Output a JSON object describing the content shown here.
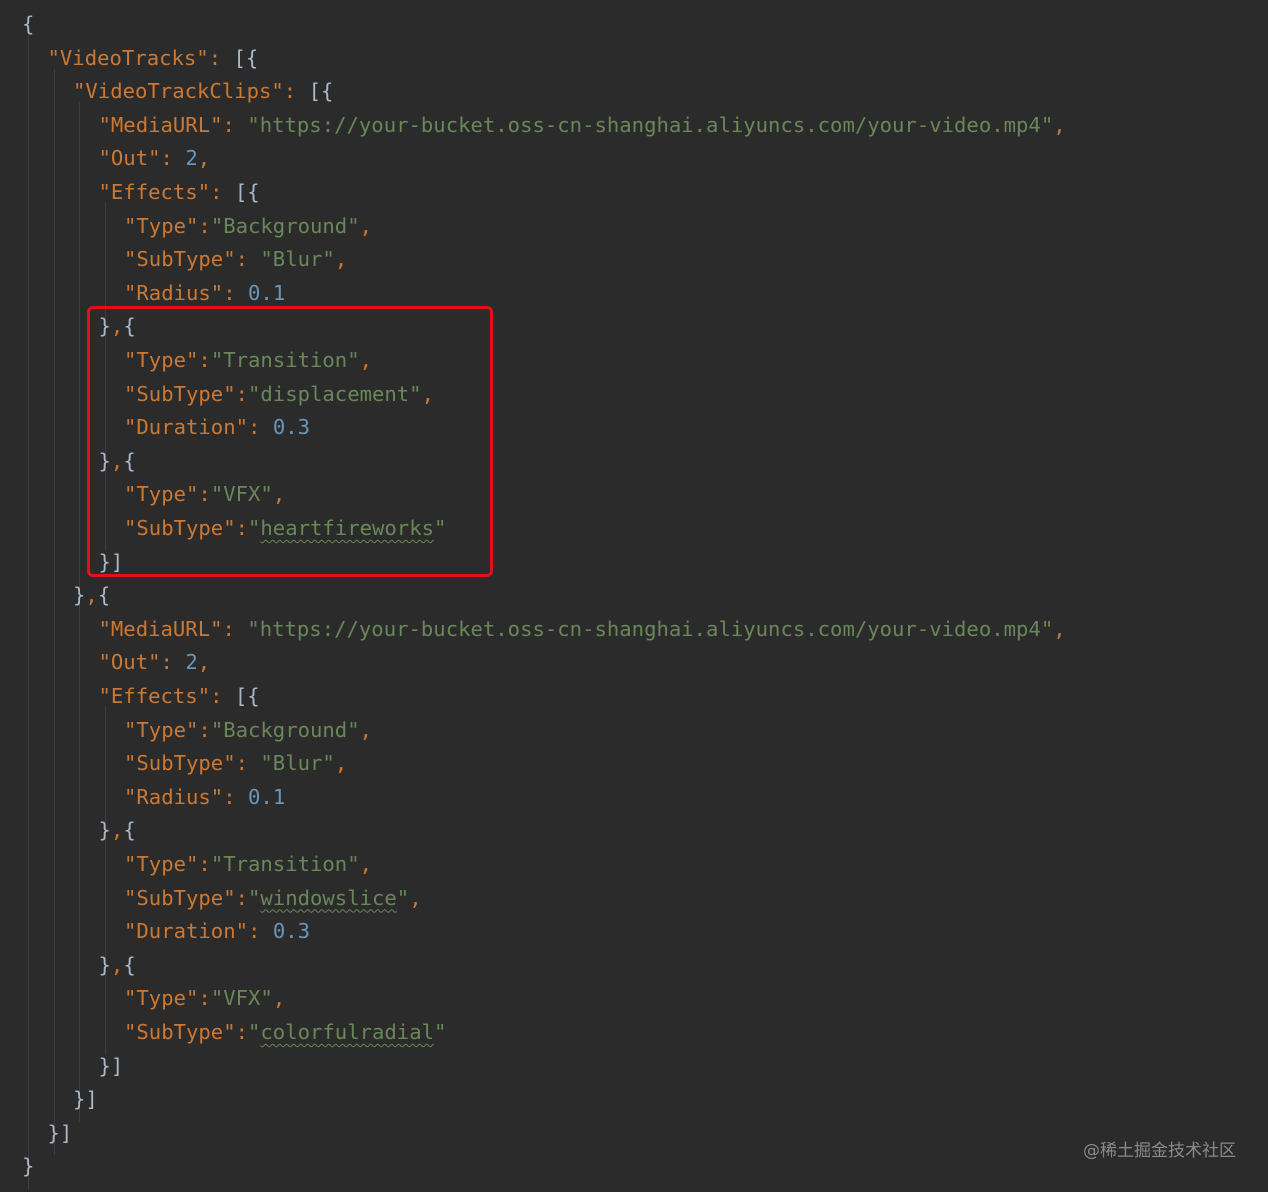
{
  "watermark": "@稀土掘金技术社区",
  "colors": {
    "background": "#2b2b2b",
    "key": "#cc7832",
    "string": "#6a8759",
    "number": "#6897bb",
    "brace": "#a9b7c6",
    "highlight": "#e3101c"
  },
  "code": [
    {
      "indent": 0,
      "tokens": [
        {
          "t": "{",
          "c": "brace"
        }
      ]
    },
    {
      "indent": 1,
      "tokens": [
        {
          "t": "\"VideoTracks\"",
          "c": "key"
        },
        {
          "t": ": ",
          "c": "punct"
        },
        {
          "t": "[{",
          "c": "brace"
        }
      ]
    },
    {
      "indent": 2,
      "tokens": [
        {
          "t": "\"VideoTrackClips\"",
          "c": "key"
        },
        {
          "t": ": ",
          "c": "punct"
        },
        {
          "t": "[{",
          "c": "brace"
        }
      ]
    },
    {
      "indent": 3,
      "tokens": [
        {
          "t": "\"MediaURL\"",
          "c": "key"
        },
        {
          "t": ": ",
          "c": "punct"
        },
        {
          "t": "\"https://your-bucket.oss-cn-shanghai.aliyuncs.com/your-video.mp4\"",
          "c": "str"
        },
        {
          "t": ",",
          "c": "punct"
        }
      ]
    },
    {
      "indent": 3,
      "tokens": [
        {
          "t": "\"Out\"",
          "c": "key"
        },
        {
          "t": ": ",
          "c": "punct"
        },
        {
          "t": "2",
          "c": "num"
        },
        {
          "t": ",",
          "c": "punct"
        }
      ]
    },
    {
      "indent": 3,
      "tokens": [
        {
          "t": "\"Effects\"",
          "c": "key"
        },
        {
          "t": ": ",
          "c": "punct"
        },
        {
          "t": "[{",
          "c": "brace"
        }
      ]
    },
    {
      "indent": 4,
      "tokens": [
        {
          "t": "\"Type\"",
          "c": "key"
        },
        {
          "t": ":",
          "c": "punct"
        },
        {
          "t": "\"Background\"",
          "c": "str"
        },
        {
          "t": ",",
          "c": "punct"
        }
      ]
    },
    {
      "indent": 4,
      "tokens": [
        {
          "t": "\"SubType\"",
          "c": "key"
        },
        {
          "t": ": ",
          "c": "punct"
        },
        {
          "t": "\"Blur\"",
          "c": "str"
        },
        {
          "t": ",",
          "c": "punct"
        }
      ]
    },
    {
      "indent": 4,
      "tokens": [
        {
          "t": "\"Radius\"",
          "c": "key"
        },
        {
          "t": ": ",
          "c": "punct"
        },
        {
          "t": "0.1",
          "c": "num"
        }
      ]
    },
    {
      "indent": 3,
      "tokens": [
        {
          "t": "}",
          "c": "brace"
        },
        {
          "t": ",",
          "c": "punct"
        },
        {
          "t": "{",
          "c": "brace"
        }
      ]
    },
    {
      "indent": 4,
      "tokens": [
        {
          "t": "\"Type\"",
          "c": "key"
        },
        {
          "t": ":",
          "c": "punct"
        },
        {
          "t": "\"Transition\"",
          "c": "str"
        },
        {
          "t": ",",
          "c": "punct"
        }
      ]
    },
    {
      "indent": 4,
      "tokens": [
        {
          "t": "\"SubType\"",
          "c": "key"
        },
        {
          "t": ":",
          "c": "punct"
        },
        {
          "t": "\"displacement\"",
          "c": "str"
        },
        {
          "t": ",",
          "c": "punct"
        }
      ]
    },
    {
      "indent": 4,
      "tokens": [
        {
          "t": "\"Duration\"",
          "c": "key"
        },
        {
          "t": ": ",
          "c": "punct"
        },
        {
          "t": "0.3",
          "c": "num"
        }
      ]
    },
    {
      "indent": 3,
      "tokens": [
        {
          "t": "}",
          "c": "brace"
        },
        {
          "t": ",",
          "c": "punct"
        },
        {
          "t": "{",
          "c": "brace"
        }
      ]
    },
    {
      "indent": 4,
      "tokens": [
        {
          "t": "\"Type\"",
          "c": "key"
        },
        {
          "t": ":",
          "c": "punct"
        },
        {
          "t": "\"VFX\"",
          "c": "str"
        },
        {
          "t": ",",
          "c": "punct"
        }
      ]
    },
    {
      "indent": 4,
      "tokens": [
        {
          "t": "\"SubType\"",
          "c": "key"
        },
        {
          "t": ":",
          "c": "punct"
        },
        {
          "t": "\"",
          "c": "str"
        },
        {
          "t": "heartfireworks",
          "c": "str",
          "typo": true
        },
        {
          "t": "\"",
          "c": "str"
        }
      ]
    },
    {
      "indent": 3,
      "tokens": [
        {
          "t": "}]",
          "c": "brace"
        }
      ]
    },
    {
      "indent": 2,
      "tokens": [
        {
          "t": "}",
          "c": "brace"
        },
        {
          "t": ",",
          "c": "punct"
        },
        {
          "t": "{",
          "c": "brace"
        }
      ]
    },
    {
      "indent": 3,
      "tokens": [
        {
          "t": "\"MediaURL\"",
          "c": "key"
        },
        {
          "t": ": ",
          "c": "punct"
        },
        {
          "t": "\"https://your-bucket.oss-cn-shanghai.aliyuncs.com/your-video.mp4\"",
          "c": "str"
        },
        {
          "t": ",",
          "c": "punct"
        }
      ]
    },
    {
      "indent": 3,
      "tokens": [
        {
          "t": "\"Out\"",
          "c": "key"
        },
        {
          "t": ": ",
          "c": "punct"
        },
        {
          "t": "2",
          "c": "num"
        },
        {
          "t": ",",
          "c": "punct"
        }
      ]
    },
    {
      "indent": 3,
      "tokens": [
        {
          "t": "\"Effects\"",
          "c": "key"
        },
        {
          "t": ": ",
          "c": "punct"
        },
        {
          "t": "[{",
          "c": "brace"
        }
      ]
    },
    {
      "indent": 4,
      "tokens": [
        {
          "t": "\"Type\"",
          "c": "key"
        },
        {
          "t": ":",
          "c": "punct"
        },
        {
          "t": "\"Background\"",
          "c": "str"
        },
        {
          "t": ",",
          "c": "punct"
        }
      ]
    },
    {
      "indent": 4,
      "tokens": [
        {
          "t": "\"SubType\"",
          "c": "key"
        },
        {
          "t": ": ",
          "c": "punct"
        },
        {
          "t": "\"Blur\"",
          "c": "str"
        },
        {
          "t": ",",
          "c": "punct"
        }
      ]
    },
    {
      "indent": 4,
      "tokens": [
        {
          "t": "\"Radius\"",
          "c": "key"
        },
        {
          "t": ": ",
          "c": "punct"
        },
        {
          "t": "0.1",
          "c": "num"
        }
      ]
    },
    {
      "indent": 3,
      "tokens": [
        {
          "t": "}",
          "c": "brace"
        },
        {
          "t": ",",
          "c": "punct"
        },
        {
          "t": "{",
          "c": "brace"
        }
      ]
    },
    {
      "indent": 4,
      "tokens": [
        {
          "t": "\"Type\"",
          "c": "key"
        },
        {
          "t": ":",
          "c": "punct"
        },
        {
          "t": "\"Transition\"",
          "c": "str"
        },
        {
          "t": ",",
          "c": "punct"
        }
      ]
    },
    {
      "indent": 4,
      "tokens": [
        {
          "t": "\"SubType\"",
          "c": "key"
        },
        {
          "t": ":",
          "c": "punct"
        },
        {
          "t": "\"",
          "c": "str"
        },
        {
          "t": "windowslice",
          "c": "str",
          "typo": true
        },
        {
          "t": "\"",
          "c": "str"
        },
        {
          "t": ",",
          "c": "punct"
        }
      ]
    },
    {
      "indent": 4,
      "tokens": [
        {
          "t": "\"Duration\"",
          "c": "key"
        },
        {
          "t": ": ",
          "c": "punct"
        },
        {
          "t": "0.3",
          "c": "num"
        }
      ]
    },
    {
      "indent": 3,
      "tokens": [
        {
          "t": "}",
          "c": "brace"
        },
        {
          "t": ",",
          "c": "punct"
        },
        {
          "t": "{",
          "c": "brace"
        }
      ]
    },
    {
      "indent": 4,
      "tokens": [
        {
          "t": "\"Type\"",
          "c": "key"
        },
        {
          "t": ":",
          "c": "punct"
        },
        {
          "t": "\"VFX\"",
          "c": "str"
        },
        {
          "t": ",",
          "c": "punct"
        }
      ]
    },
    {
      "indent": 4,
      "tokens": [
        {
          "t": "\"SubType\"",
          "c": "key"
        },
        {
          "t": ":",
          "c": "punct"
        },
        {
          "t": "\"",
          "c": "str"
        },
        {
          "t": "colorfulradial",
          "c": "str",
          "typo": true
        },
        {
          "t": "\"",
          "c": "str"
        }
      ]
    },
    {
      "indent": 3,
      "tokens": [
        {
          "t": "}]",
          "c": "brace"
        }
      ]
    },
    {
      "indent": 2,
      "tokens": [
        {
          "t": "}]",
          "c": "brace"
        }
      ]
    },
    {
      "indent": 1,
      "tokens": [
        {
          "t": "}]",
          "c": "brace"
        }
      ]
    },
    {
      "indent": 0,
      "tokens": [
        {
          "t": "}",
          "c": "brace"
        }
      ]
    }
  ]
}
